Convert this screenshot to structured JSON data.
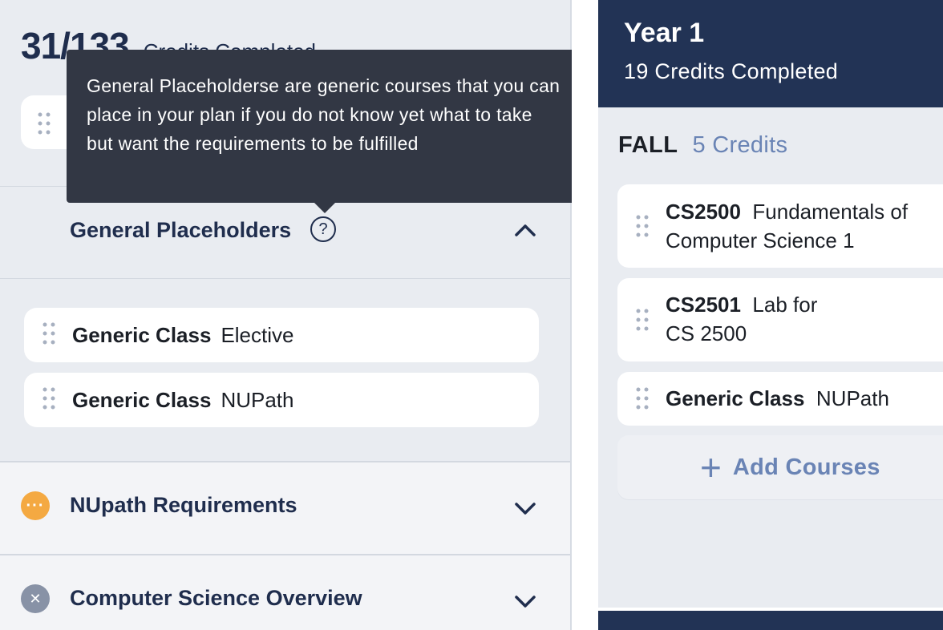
{
  "sidebar": {
    "credits_count": "31/133",
    "credits_label": "Credits Completed",
    "general_placeholders": {
      "title": "General Placeholders",
      "help_symbol": "?",
      "tooltip": "General Placeholderse are generic courses that you can place in your plan if you do not know yet what to take but want the requirements to be fulfilled",
      "expanded": true,
      "classes": [
        {
          "code": "Generic Class",
          "name": "Elective"
        },
        {
          "code": "Generic Class",
          "name": "NUPath"
        }
      ]
    },
    "sections": [
      {
        "title": "NUpath Requirements",
        "status": "in-progress",
        "status_color": "#f4a942",
        "status_symbol": "···"
      },
      {
        "title": "Computer Science Overview",
        "status": "incomplete",
        "status_color": "#8892a6",
        "status_symbol": "✕"
      }
    ]
  },
  "plan": {
    "year_title": "Year 1",
    "year_credits": "19 Credits Completed",
    "term": {
      "name": "FALL",
      "credits": "5 Credits",
      "courses": [
        {
          "code": "CS2500",
          "name": "Fundamentals of Computer Science 1"
        },
        {
          "code": "CS2501",
          "name": "Lab for CS 2500"
        },
        {
          "code": "Generic Class",
          "name": "NUPath"
        }
      ]
    },
    "add_courses_label": "Add Courses",
    "add_courses_symbol": "+"
  },
  "colors": {
    "navy": "#223355",
    "accent_blue": "#6a84b5",
    "tooltip_bg": "#323744"
  }
}
